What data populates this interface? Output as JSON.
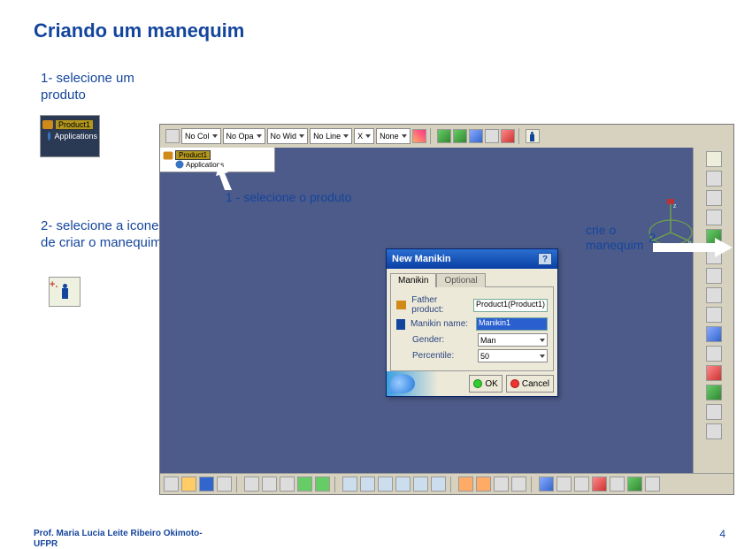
{
  "title": "Criando um manequim",
  "step1": "1- selecione um produto",
  "step2": "2- selecione a icone de criar o manequim",
  "callout1": "1 - selecione o produto",
  "callout2_text": "crie o\nmanequim",
  "callout2_num": "2",
  "product_tree": {
    "product_label": "Product1",
    "applications_label": "Applications"
  },
  "top_toolbar": {
    "dd_nocolor": "No Col",
    "dd_noopacity": "No Opa",
    "dd_nowidth": "No Wid",
    "dd_noline": "No Line",
    "dd_x": "X",
    "dd_none": "None"
  },
  "dialog": {
    "title": "New Manikin",
    "tab_manikin": "Manikin",
    "tab_optional": "Optional",
    "father_label": "Father product:",
    "father_value": "Product1(Product1)",
    "name_label": "Manikin name:",
    "name_value": "Manikin1",
    "gender_label": "Gender:",
    "gender_value": "Man",
    "percentile_label": "Percentile:",
    "percentile_value": "50",
    "btn_ok": "OK",
    "btn_cancel": "Cancel"
  },
  "footer_line1": "Prof. Maria Lucia Leite Ribeiro Okimoto-",
  "footer_line2": "UFPR",
  "page_number": "4"
}
